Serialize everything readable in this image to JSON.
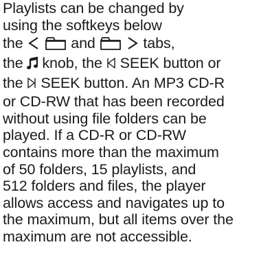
{
  "paragraph": {
    "l1": "Playlists can be changed by",
    "l2": "using the softkeys below",
    "l3_pre": "the",
    "l3_mid": "and",
    "l3_post": "tabs,",
    "l4_pre": "the",
    "l4_mid": "knob, the",
    "l4_post": "SEEK button or",
    "l5_pre": "the",
    "l5_post": "SEEK button. An MP3 CD-R",
    "l6": "or CD-RW that has been recorded",
    "l7": "without using file folders can be",
    "l8": "played. If a CD-R or CD-RW",
    "l9": "contains more than the maximum",
    "l10": "of 50 folders, 15 playlists, and",
    "l11": "512 folders and files, the player",
    "l12": "allows access and navigates up to",
    "l13": "the maximum, but all items over the",
    "l14": "maximum are not accessible."
  },
  "icons": {
    "left_chevron": "chevron-left-icon",
    "folder_1": "folder-icon",
    "folder_2": "folder-icon",
    "right_chevron": "chevron-right-icon",
    "music_note": "music-note-icon",
    "seek_back": "seek-back-icon",
    "seek_forward": "seek-forward-icon"
  }
}
